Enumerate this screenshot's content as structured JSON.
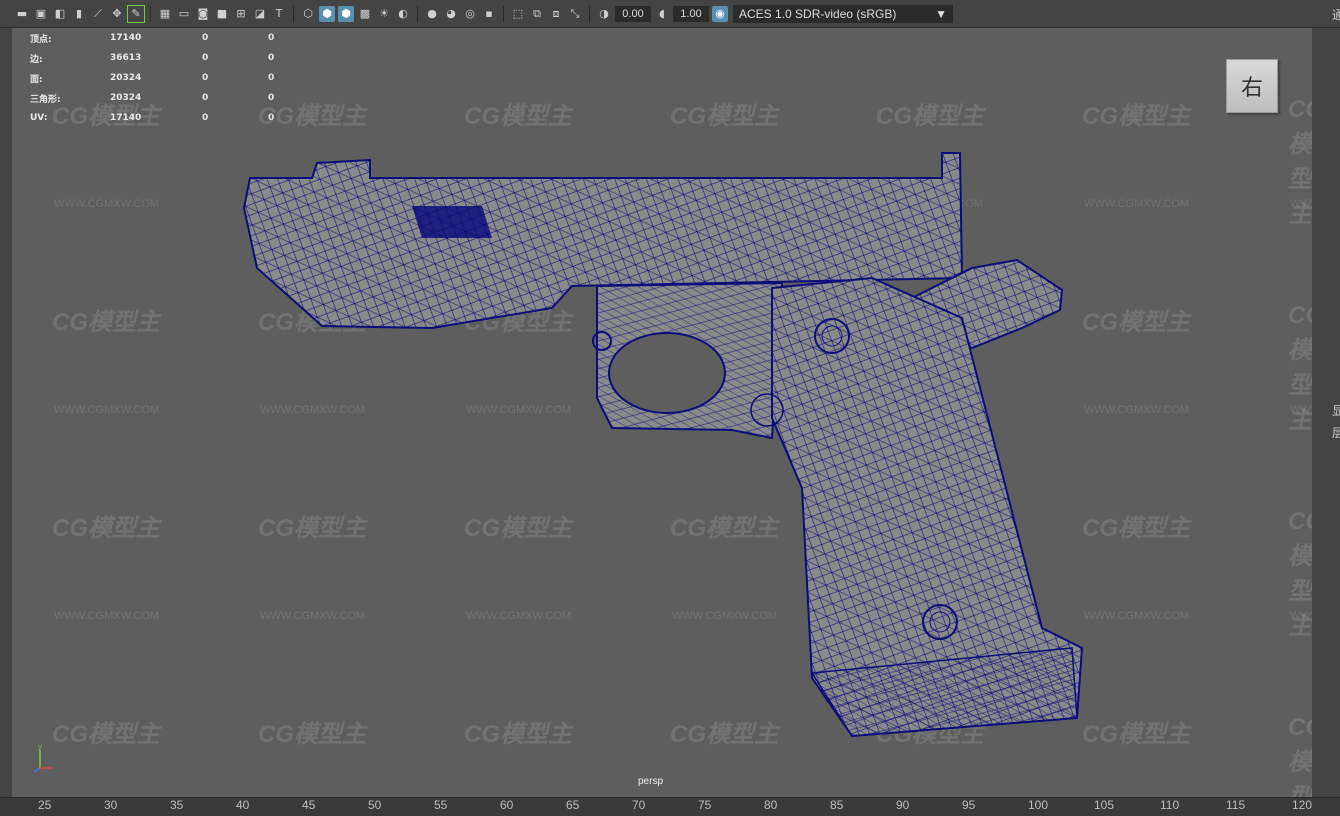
{
  "toolbar": {
    "exposure": "0.00",
    "gamma": "1.00",
    "color_mgmt_label": "ACES 1.0 SDR-video (sRGB)"
  },
  "hud": {
    "rows": [
      {
        "label": "顶点:",
        "v1": "17140",
        "v2": "0",
        "v3": "0"
      },
      {
        "label": "边:",
        "v1": "36613",
        "v2": "0",
        "v3": "0"
      },
      {
        "label": "面:",
        "v1": "20324",
        "v2": "0",
        "v3": "0"
      },
      {
        "label": "三角形:",
        "v1": "20324",
        "v2": "0",
        "v3": "0"
      },
      {
        "label": "UV:",
        "v1": "17140",
        "v2": "0",
        "v3": "0"
      }
    ]
  },
  "viewcube": {
    "label": "右"
  },
  "camera": {
    "label": "persp"
  },
  "axis": {
    "x": "x",
    "y": "y"
  },
  "ruler": {
    "ticks": [
      "25",
      "30",
      "35",
      "40",
      "45",
      "50",
      "55",
      "60",
      "65",
      "70",
      "75",
      "80",
      "85",
      "90",
      "95",
      "100",
      "105",
      "110",
      "115",
      "120"
    ]
  },
  "right_panel": {
    "top_char": "通",
    "mid_chars": [
      "显",
      "层"
    ]
  },
  "watermark": {
    "logo": "CG模型主",
    "url": "WWW.CGMXW.COM"
  },
  "colors": {
    "wire": "#0c0c7a",
    "mesh_fill": "#8a8a8a",
    "viewport_bg": "#5e5e5e"
  }
}
